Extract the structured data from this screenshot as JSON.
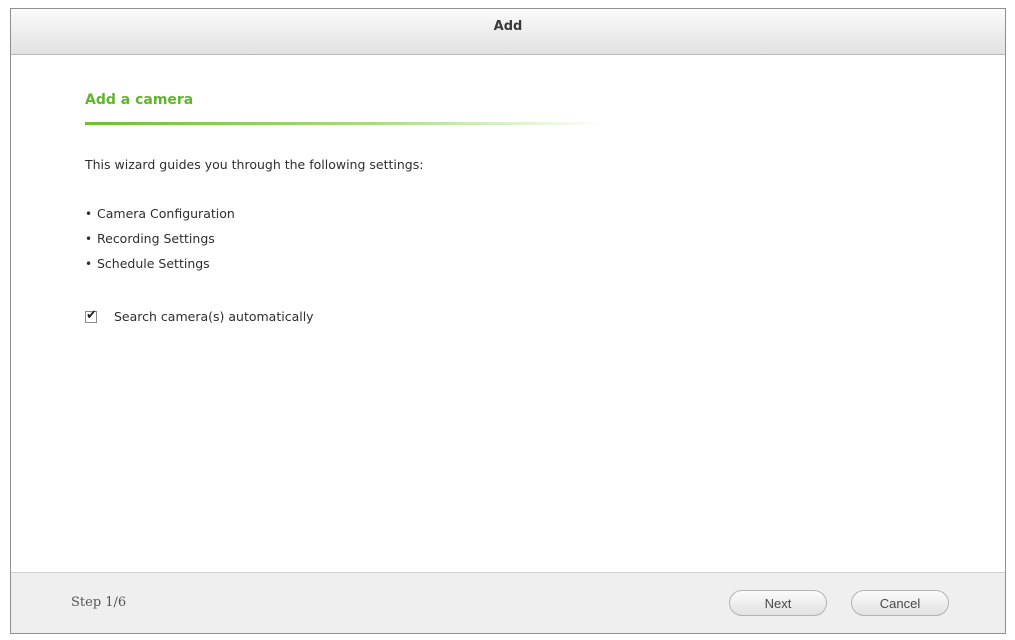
{
  "dialog": {
    "title": "Add"
  },
  "wizard": {
    "heading": "Add a camera",
    "intro": "This wizard guides you through the following settings:",
    "items": [
      "Camera Configuration",
      "Recording Settings",
      "Schedule Settings"
    ],
    "search_checkbox": {
      "label": "Search camera(s) automatically",
      "checked": true
    }
  },
  "footer": {
    "step": "Step 1/6",
    "next_label": "Next",
    "cancel_label": "Cancel"
  },
  "colors": {
    "accent": "#5fb62a"
  }
}
